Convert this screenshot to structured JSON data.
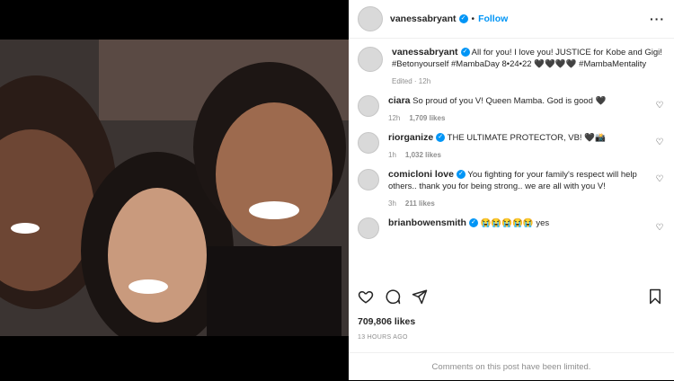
{
  "header": {
    "username": "vanessabryant",
    "follow_label": "Follow",
    "separator": "•"
  },
  "caption": {
    "username": "vanessabryant",
    "text": "All for you! I love you! JUSTICE for Kobe and Gigi! #Betonyourself #MambaDay 8•24•22 🖤🖤🖤🖤 #MambaMentality",
    "meta": "Edited · 12h"
  },
  "comments": [
    {
      "user": "ciara",
      "text": "So proud of you V! Queen Mamba. God is good 🖤",
      "time": "12h",
      "likes": "1,709 likes",
      "verified": false
    },
    {
      "user": "riorganize",
      "text": "THE ULTIMATE PROTECTOR, VB! 🖤📸",
      "time": "1h",
      "likes": "1,032 likes",
      "verified": true
    },
    {
      "user": "comicloni love",
      "text": "You fighting for your family's respect will help others.. thank you for being strong.. we are all with you V!",
      "time": "3h",
      "likes": "211 likes",
      "verified": true
    },
    {
      "user": "brianbowensmith",
      "text": "😭😭😭😭😭 yes",
      "time": "",
      "likes": "",
      "verified": true
    }
  ],
  "likes_count": "709,806 likes",
  "timestamp": "13 HOURS AGO",
  "limited_notice": "Comments on this post have been limited.",
  "colors": {
    "accent": "#0095f6",
    "muted": "#8e8e8e",
    "text": "#262626"
  },
  "icons": [
    "heart-icon",
    "comment-icon",
    "share-icon",
    "bookmark-icon",
    "more-icon",
    "verified-icon"
  ]
}
